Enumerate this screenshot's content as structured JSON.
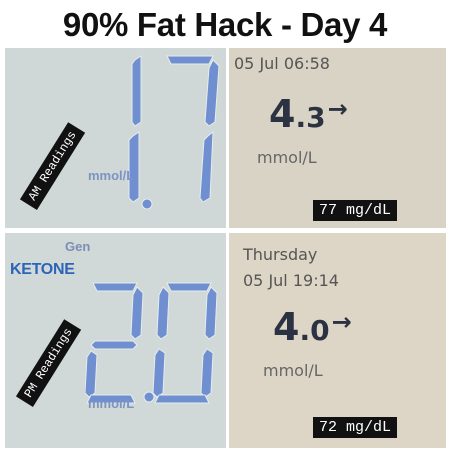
{
  "title": "90% Fat Hack - Day 4",
  "am": {
    "label": "AM Readings",
    "ketone_value": "1.7",
    "ketone_unit": "mmol/L",
    "glucose_datetime": "05 Jul 06:58",
    "glucose_whole": "4",
    "glucose_decimal": ".3",
    "glucose_trend": "→",
    "glucose_unit": "mmol/L",
    "glucose_mgdl": "77 mg/dL"
  },
  "pm": {
    "label": "PM Readings",
    "meter_gen": "Gen",
    "meter_ketone": "KETONE",
    "ketone_value": "2.0",
    "ketone_unit": "mmol/L",
    "glucose_day": "Thursday",
    "glucose_datetime": "05 Jul 19:14",
    "glucose_whole": "4",
    "glucose_decimal": ".0",
    "glucose_trend": "→",
    "glucose_unit": "mmol/L",
    "glucose_mgdl": "72 mg/dL"
  },
  "colors": {
    "lcd_digits": "#6f8fd1",
    "meter_brand": "#2d64b8",
    "glucose_text": "#2b3342"
  }
}
